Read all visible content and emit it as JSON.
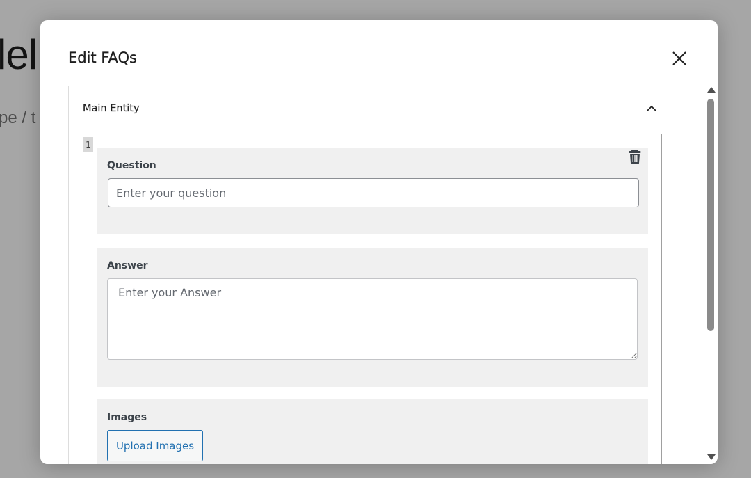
{
  "background": {
    "title_fragment": "lel",
    "breadcrumb_fragment": "pe / t"
  },
  "modal": {
    "title": "Edit FAQs",
    "close_icon": "close-icon"
  },
  "panel": {
    "title": "Main Entity",
    "toggle_icon": "chevron-up-icon",
    "expanded": true
  },
  "item": {
    "index": "1",
    "question": {
      "label": "Question",
      "value": "",
      "placeholder": "Enter your question"
    },
    "answer": {
      "label": "Answer",
      "value": "",
      "placeholder": "Enter your Answer"
    },
    "images": {
      "label": "Images",
      "button_label": "Upload Images"
    },
    "delete_icon": "trash-icon"
  },
  "colors": {
    "accent": "#2271b1",
    "field_background": "#f0f0f0",
    "overlay": "rgba(0,0,0,0.35)"
  }
}
